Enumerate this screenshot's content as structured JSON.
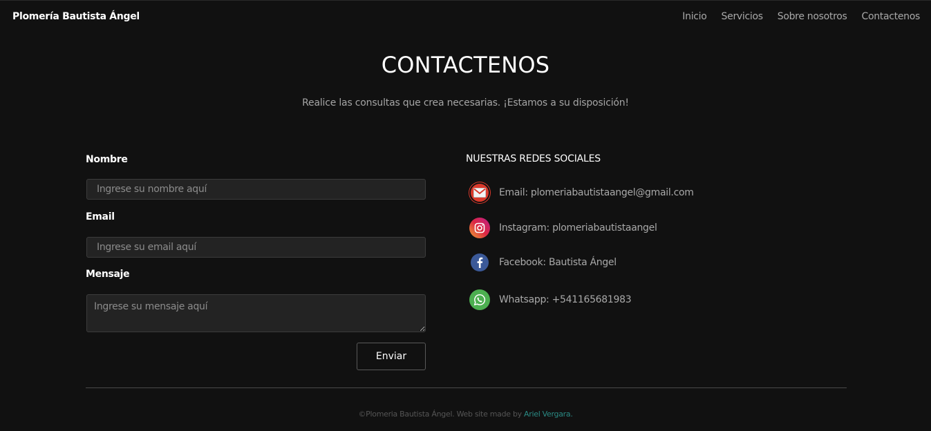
{
  "nav": {
    "brand": "Plomería Bautista Ángel",
    "links": [
      "Inicio",
      "Servicios",
      "Sobre nosotros",
      "Contactenos"
    ]
  },
  "header": {
    "title": "CONTACTENOS",
    "subtitle": "Realice las consultas que crea necesarias. ¡Estamos a su disposición!"
  },
  "form": {
    "name_label": "Nombre",
    "name_placeholder": "Ingrese su nombre aquí",
    "email_label": "Email",
    "email_placeholder": "Ingrese su email aquí",
    "message_label": "Mensaje",
    "message_placeholder": "Ingrese su mensaje aquí",
    "send_label": "Enviar"
  },
  "social": {
    "title": "NUESTRAS REDES SOCIALES",
    "items": [
      {
        "icon": "email-icon",
        "text": "Email: plomeriabautistaangel@gmail.com",
        "color": "#d9392b"
      },
      {
        "icon": "instagram-icon",
        "text": "Instagram: plomeriabautistaangel",
        "color": "#e1306c"
      },
      {
        "icon": "facebook-icon",
        "text": "Facebook: Bautista Ángel",
        "color": "#3b5998"
      },
      {
        "icon": "whatsapp-icon",
        "text": "Whatsapp: +541165681983",
        "color": "#4caf50"
      }
    ]
  },
  "footer": {
    "copyright": "©Plomeria Bautista Ángel. Web site made by",
    "author": "Ariel Vergara."
  }
}
